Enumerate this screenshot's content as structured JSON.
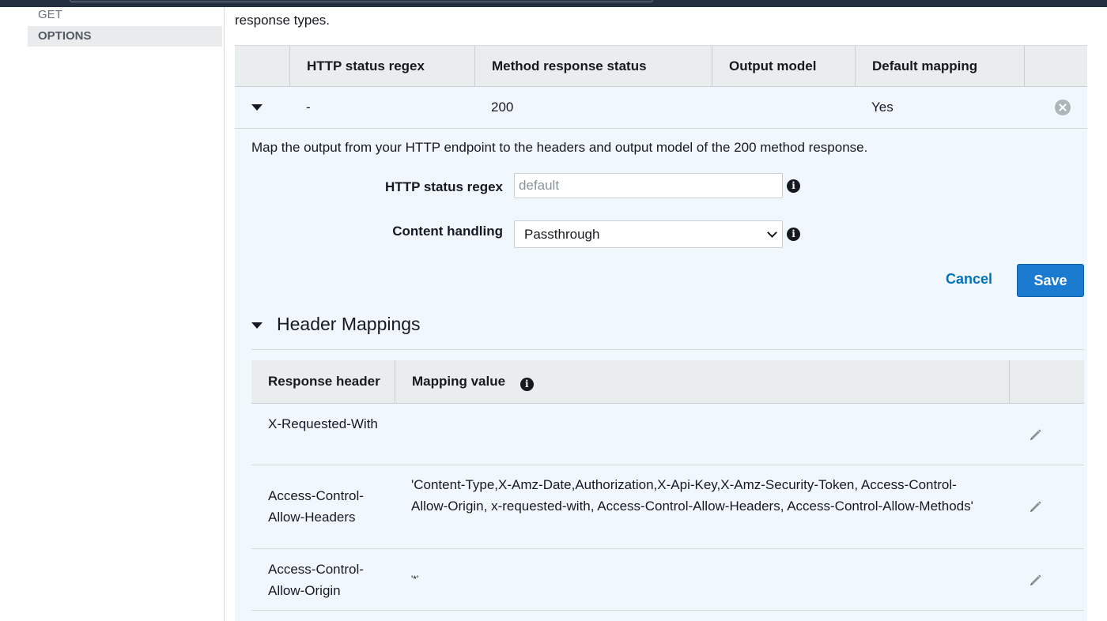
{
  "sidebar": {
    "items": [
      {
        "label": "GET"
      },
      {
        "label": "OPTIONS"
      }
    ]
  },
  "main": {
    "intro_text": "response types.",
    "response_table": {
      "headers": [
        "",
        "HTTP status regex",
        "Method response status",
        "Output model",
        "Default mapping",
        ""
      ],
      "row": {
        "regex": "-",
        "status": "200",
        "output_model": "",
        "default_mapping": "Yes"
      }
    },
    "description": "Map the output from your HTTP endpoint to the headers and output model of the 200 method response.",
    "form": {
      "regex_label": "HTTP status regex",
      "regex_value": "",
      "regex_placeholder": "default",
      "content_label": "Content handling",
      "content_value": "Passthrough"
    },
    "buttons": {
      "cancel": "Cancel",
      "save": "Save"
    },
    "header_mappings": {
      "title": "Header Mappings",
      "headers": [
        "Response header",
        "Mapping value",
        ""
      ],
      "rows": [
        {
          "name": "X-Requested-With",
          "value": ""
        },
        {
          "name": "Access-Control-Allow-Headers",
          "value": "'Content-Type,X-Amz-Date,Authorization,X-Api-Key,X-Amz-Security-Token, Access-Control-Allow-Origin, x-requested-with, Access-Control-Allow-Headers, Access-Control-Allow-Methods'"
        },
        {
          "name": "Access-Control-Allow-Origin",
          "value": "'*'"
        }
      ]
    }
  },
  "icons": {
    "info": "info-icon",
    "remove": "remove-icon",
    "edit": "pencil-icon",
    "expand": "caret-down-icon",
    "select": "chevron-down-icon"
  },
  "colors": {
    "link": "#0073bb",
    "primary_button": "#1a7bd1",
    "panel_bg": "#f1f8fd",
    "header_bg": "#eaeded"
  }
}
